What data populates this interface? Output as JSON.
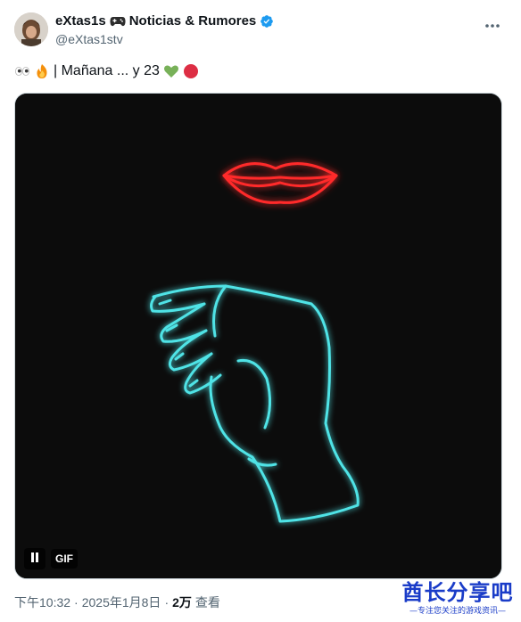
{
  "author": {
    "display_name": "eXtas1s",
    "display_name_suffix": "Noticias & Rumores",
    "handle": "@eXtas1stv",
    "name_icon": "gamepad-icon",
    "verified_icon": "verified-badge-icon",
    "verified_color": "#1d9bf0"
  },
  "more_button": {
    "icon": "more-horizontal-icon"
  },
  "tweet": {
    "text": "| Mañana ... y 23",
    "leading_emojis": [
      "eyes-emoji",
      "fire-emoji"
    ],
    "trailing_emojis": [
      "green-heart-emoji",
      "red-circle-emoji"
    ]
  },
  "media": {
    "type": "gif",
    "gif_label": "GIF",
    "pause_icon": "pause-icon",
    "lips_color": "#ff2a2a",
    "hand_color": "#4fe3e6",
    "background_color": "#0c0c0c"
  },
  "meta": {
    "time": "下午10:32",
    "separator": "·",
    "date": "2025年1月8日",
    "views": "2万",
    "views_label": "查看"
  },
  "watermark": {
    "title": "酋长分享吧",
    "subtitle": "—专注您关注的游戏资讯—"
  }
}
